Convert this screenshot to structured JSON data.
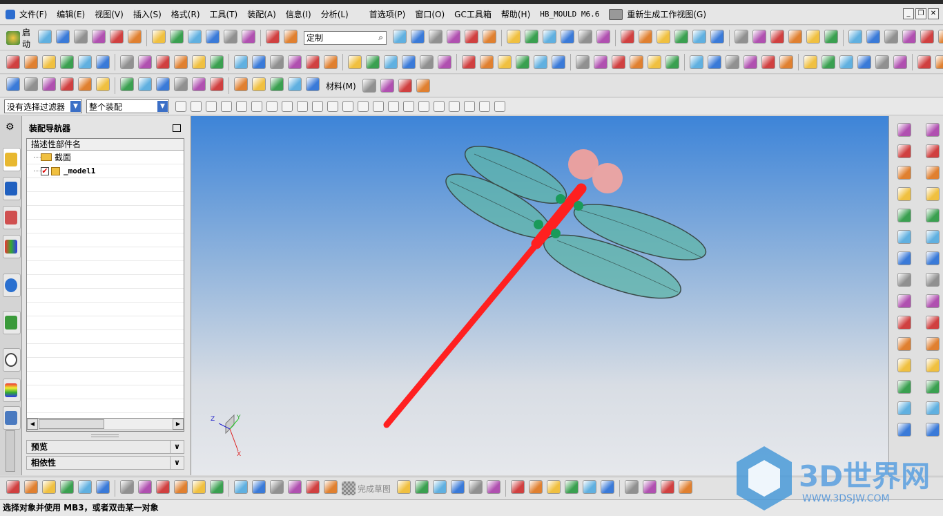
{
  "menubar": {
    "items": [
      "文件(F)",
      "编辑(E)",
      "视图(V)",
      "插入(S)",
      "格式(R)",
      "工具(T)",
      "装配(A)",
      "信息(I)",
      "分析(L)",
      "首选项(P)",
      "窗口(O)",
      "GC工具箱",
      "帮助(H)",
      "HB_MOULD M6.6"
    ],
    "regenerate": "重新生成工作视图(G)"
  },
  "toolbar1": {
    "start_label": "启动",
    "customize_value": "定制"
  },
  "toolbar3": {
    "material_label": "材料(M)"
  },
  "selection_bar": {
    "filter_value": "没有选择过滤器",
    "scope_value": "整个装配"
  },
  "navigator": {
    "title": "装配导航器",
    "column_header": "描述性部件名",
    "rows": [
      {
        "label": "截面",
        "icon": "folder-icon"
      },
      {
        "label": "_model1",
        "icon": "component-icon",
        "checked": true
      }
    ],
    "preview_label": "预览",
    "dependency_label": "相依性"
  },
  "triad": {
    "x": "X",
    "y": "Y",
    "z": "Z"
  },
  "bottom_toolbar": {
    "finish_sketch": "完成草图"
  },
  "status": {
    "message": "选择对象并使用 MB3，或者双击某一对象"
  },
  "watermark": {
    "title": "3D世界网",
    "url": "WWW.3DSJW.COM"
  },
  "colors": {
    "viewport_top": "#3d84d8",
    "viewport_bottom": "#e6e8ec",
    "body": "#ff2020",
    "wings": "#5fb5a8",
    "eyes": "#e8a0a0",
    "joints": "#1a9a5a"
  }
}
